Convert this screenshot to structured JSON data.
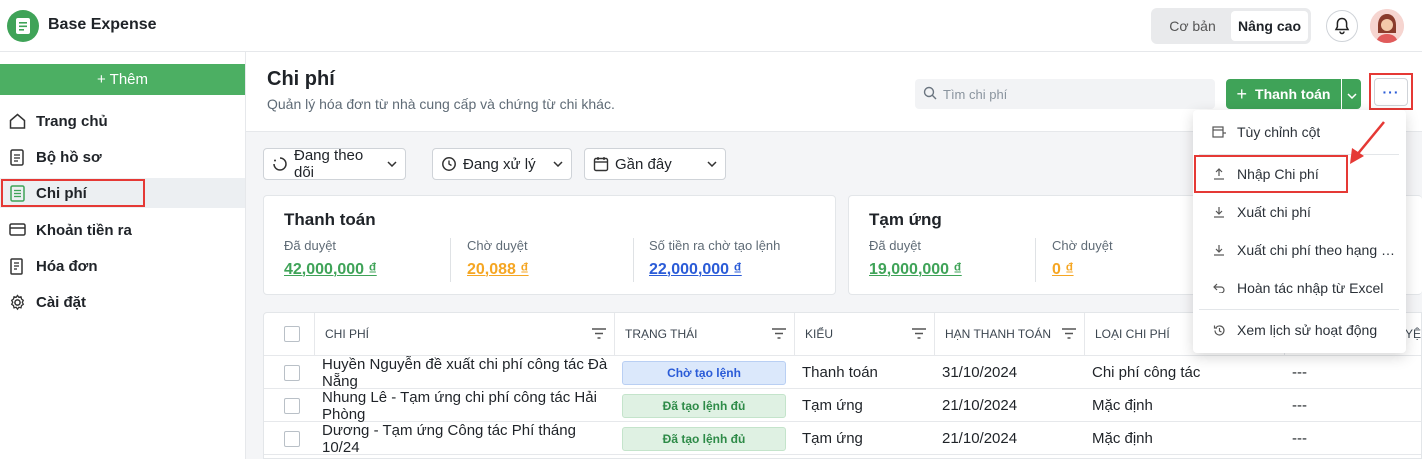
{
  "app": {
    "name": "Base Expense"
  },
  "topbar": {
    "modes": [
      {
        "label": "Cơ bản",
        "active": false
      },
      {
        "label": "Nâng cao",
        "active": true
      }
    ],
    "bell_icon": "bell-icon",
    "avatar_icon": "user-avatar"
  },
  "sidebar": {
    "add_label": "+ Thêm",
    "items": [
      {
        "label": "Trang chủ",
        "icon": "home-icon",
        "active": false
      },
      {
        "label": "Bộ hồ sơ",
        "icon": "document-icon",
        "active": false
      },
      {
        "label": "Chi phí",
        "icon": "expense-list-icon",
        "active": true
      },
      {
        "label": "Khoản tiền ra",
        "icon": "card-icon",
        "active": false
      },
      {
        "label": "Hóa đơn",
        "icon": "invoice-icon",
        "active": false
      },
      {
        "label": "Cài đặt",
        "icon": "gear-icon",
        "active": false
      }
    ]
  },
  "header": {
    "title": "Chi phí",
    "subtitle": "Quản lý hóa đơn từ nhà cung cấp và chứng từ chi khác.",
    "search_placeholder": "Tìm chi phí",
    "pay_button": "Thanh toán",
    "more_label": "···"
  },
  "filters": [
    {
      "label": "Đang theo dõi",
      "icon": "spinner-icon"
    },
    {
      "label": "Đang xử lý",
      "icon": "clock-icon"
    },
    {
      "label": "Gần đây",
      "icon": "calendar-icon"
    }
  ],
  "cards": {
    "payment": {
      "title": "Thanh toán",
      "stats": [
        {
          "label": "Đã duyệt",
          "value": "42,000,000 ₫",
          "color": "#3fa358"
        },
        {
          "label": "Chờ duyệt",
          "value": "20,088 ₫",
          "color": "#f5a623"
        },
        {
          "label": "Số tiền ra chờ tạo lệnh",
          "value": "22,000,000 ₫",
          "color": "#2a5bd7"
        }
      ]
    },
    "advance": {
      "title": "Tạm ứng",
      "stats": [
        {
          "label": "Đã duyệt",
          "value": "19,000,000 ₫",
          "color": "#3fa358"
        },
        {
          "label": "Chờ duyệt",
          "value": "0 ₫",
          "color": "#f5a623"
        }
      ]
    }
  },
  "table": {
    "columns": [
      "CHI PHÍ",
      "TRẠNG THÁI",
      "KIỂU",
      "HẠN THANH TOÁN",
      "LOẠI CHI PHÍ",
      "YỆ"
    ],
    "rows": [
      {
        "name": "Huyền Nguyễn đề xuất chi phí công tác Đà Nẵng",
        "status": "Chờ tạo lệnh",
        "status_color": "blue",
        "type": "Thanh toán",
        "due": "31/10/2024",
        "category": "Chi phí công tác",
        "extra": "---"
      },
      {
        "name": "Nhung Lê - Tạm ứng chi phí công tác Hải Phòng",
        "status": "Đã tạo lệnh đủ",
        "status_color": "green",
        "type": "Tạm ứng",
        "due": "21/10/2024",
        "category": "Mặc định",
        "extra": "---"
      },
      {
        "name": "Dương - Tạm ứng Công tác Phí tháng 10/24",
        "status": "Đã tạo lệnh đủ",
        "status_color": "green",
        "type": "Tạm ứng",
        "due": "21/10/2024",
        "category": "Mặc định",
        "extra": "---"
      }
    ]
  },
  "dropdown": {
    "items": [
      {
        "label": "Tùy chỉnh cột",
        "icon": "columns-icon"
      },
      {
        "label": "Nhập Chi phí",
        "icon": "upload-icon"
      },
      {
        "label": "Xuất chi phí",
        "icon": "download-icon"
      },
      {
        "label": "Xuất chi phí theo hạng mục",
        "icon": "download-icon"
      },
      {
        "label": "Hoàn tác nhập từ Excel",
        "icon": "undo-icon"
      },
      {
        "label": "Xem lịch sử hoạt động",
        "icon": "history-icon"
      }
    ]
  },
  "colors": {
    "brand_green": "#3fa358",
    "highlight_red": "#e53935",
    "link_blue": "#2a5bd7"
  }
}
